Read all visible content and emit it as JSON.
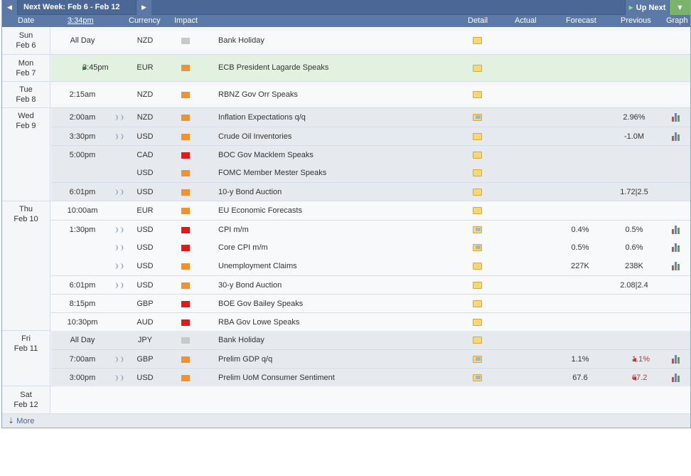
{
  "topbar": {
    "week_title": "Next Week: Feb 6 - Feb 12",
    "up_next": "Up Next",
    "prev": "◄",
    "next": "►"
  },
  "header": {
    "date": "Date",
    "time": "3:34pm",
    "currency": "Currency",
    "impact": "Impact",
    "detail": "Detail",
    "actual": "Actual",
    "forecast": "Forecast",
    "previous": "Previous",
    "graph": "Graph"
  },
  "days": [
    {
      "dow": "Sun",
      "date": "Feb 6"
    },
    {
      "dow": "Mon",
      "date": "Feb 7"
    },
    {
      "dow": "Tue",
      "date": "Feb 8"
    },
    {
      "dow": "Wed",
      "date": "Feb 9"
    },
    {
      "dow": "Thu",
      "date": "Feb 10"
    },
    {
      "dow": "Fri",
      "date": "Feb 11"
    },
    {
      "dow": "Sat",
      "date": "Feb 12"
    }
  ],
  "events": [
    {
      "time": "All Day",
      "currency": "NZD",
      "impact": "grey",
      "event": "Bank Holiday",
      "forecast": "",
      "previous": ""
    },
    {
      "time": "3:45pm",
      "currency": "EUR",
      "impact": "orange",
      "event": "ECB President Lagarde Speaks",
      "forecast": "",
      "previous": ""
    },
    {
      "time": "2:15am",
      "currency": "NZD",
      "impact": "orange",
      "event": "RBNZ Gov Orr Speaks",
      "forecast": "",
      "previous": ""
    },
    {
      "time": "2:00am",
      "currency": "NZD",
      "impact": "orange",
      "event": "Inflation Expectations q/q",
      "forecast": "",
      "previous": "2.96%"
    },
    {
      "time": "3:30pm",
      "currency": "USD",
      "impact": "orange",
      "event": "Crude Oil Inventories",
      "forecast": "",
      "previous": "-1.0M"
    },
    {
      "time": "5:00pm",
      "currency": "CAD",
      "impact": "red",
      "event": "BOC Gov Macklem Speaks",
      "forecast": "",
      "previous": ""
    },
    {
      "time": "",
      "currency": "USD",
      "impact": "orange",
      "event": "FOMC Member Mester Speaks",
      "forecast": "",
      "previous": ""
    },
    {
      "time": "6:01pm",
      "currency": "USD",
      "impact": "orange",
      "event": "10-y Bond Auction",
      "forecast": "",
      "previous": "1.72|2.5"
    },
    {
      "time": "10:00am",
      "currency": "EUR",
      "impact": "orange",
      "event": "EU Economic Forecasts",
      "forecast": "",
      "previous": ""
    },
    {
      "time": "1:30pm",
      "currency": "USD",
      "impact": "red",
      "event": "CPI m/m",
      "forecast": "0.4%",
      "previous": "0.5%"
    },
    {
      "time": "",
      "currency": "USD",
      "impact": "red",
      "event": "Core CPI m/m",
      "forecast": "0.5%",
      "previous": "0.6%"
    },
    {
      "time": "",
      "currency": "USD",
      "impact": "orange",
      "event": "Unemployment Claims",
      "forecast": "227K",
      "previous": "238K"
    },
    {
      "time": "6:01pm",
      "currency": "USD",
      "impact": "orange",
      "event": "30-y Bond Auction",
      "forecast": "",
      "previous": "2.08|2.4"
    },
    {
      "time": "8:15pm",
      "currency": "GBP",
      "impact": "red",
      "event": "BOE Gov Bailey Speaks",
      "forecast": "",
      "previous": ""
    },
    {
      "time": "10:30pm",
      "currency": "AUD",
      "impact": "red",
      "event": "RBA Gov Lowe Speaks",
      "forecast": "",
      "previous": ""
    },
    {
      "time": "All Day",
      "currency": "JPY",
      "impact": "grey",
      "event": "Bank Holiday",
      "forecast": "",
      "previous": ""
    },
    {
      "time": "7:00am",
      "currency": "GBP",
      "impact": "orange",
      "event": "Prelim GDP q/q",
      "forecast": "1.1%",
      "previous": "1.1%"
    },
    {
      "time": "3:00pm",
      "currency": "USD",
      "impact": "orange",
      "event": "Prelim UoM Consumer Sentiment",
      "forecast": "67.6",
      "previous": "67.2"
    }
  ],
  "footer": {
    "more": "More"
  },
  "colors": {
    "header_bg": "#4a6795",
    "impact_red": "#e01a1a",
    "impact_orange": "#f0922f",
    "impact_grey": "#c8c8c8",
    "revised_red": "#c0392b"
  }
}
